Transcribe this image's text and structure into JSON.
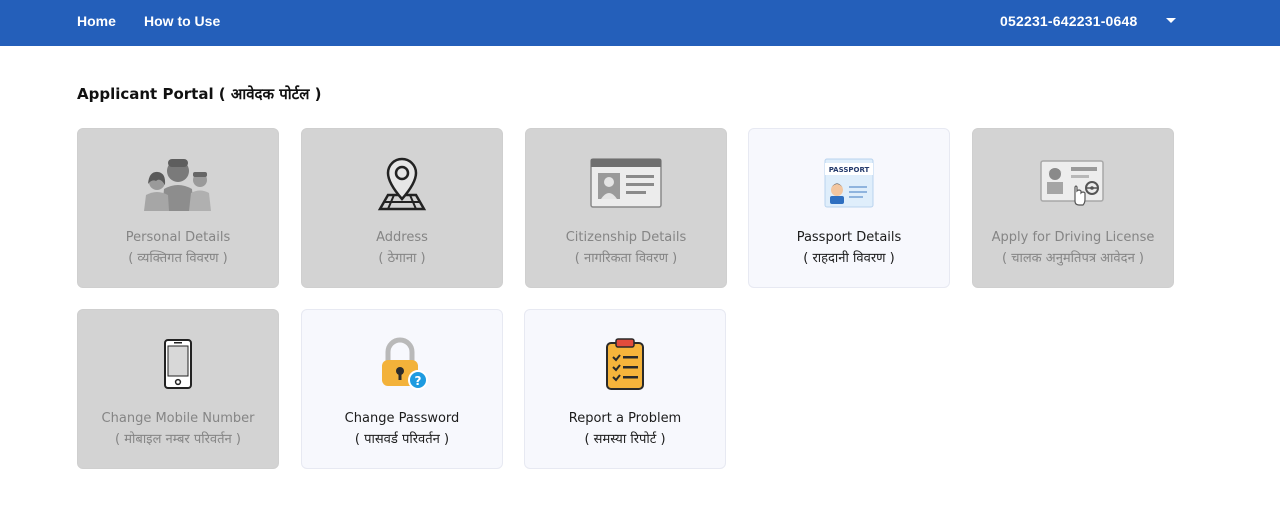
{
  "nav": {
    "home": "Home",
    "how_to_use": "How to Use",
    "user_id": "052231-642231-0648"
  },
  "page": {
    "title": "Applicant Portal ( आवेदक पोर्टल )"
  },
  "cards": [
    {
      "en": "Personal Details",
      "ne": "( व्यक्तिगत विवरण )",
      "icon": "people-icon",
      "state": "disabled"
    },
    {
      "en": "Address",
      "ne": "( ठेगाना )",
      "icon": "map-pin-icon",
      "state": "disabled"
    },
    {
      "en": "Citizenship Details",
      "ne": "( नागरिकता विवरण )",
      "icon": "id-card-icon",
      "state": "disabled"
    },
    {
      "en": "Passport Details",
      "ne": "( राहदानी विवरण )",
      "icon": "passport-icon",
      "state": "enabled"
    },
    {
      "en": "Apply for Driving License",
      "ne": "( चालक अनुमतिपत्र आवेदन )",
      "icon": "driving-license-icon",
      "state": "disabled"
    },
    {
      "en": "Change Mobile Number",
      "ne": "( मोबाइल नम्बर परिवर्तन )",
      "icon": "mobile-phone-icon",
      "state": "disabled"
    },
    {
      "en": "Change Password",
      "ne": "( पासवर्ड परिवर्तन )",
      "icon": "padlock-icon",
      "state": "enabled"
    },
    {
      "en": "Report a Problem",
      "ne": "( समस्या रिपोर्ट )",
      "icon": "clipboard-checklist-icon",
      "state": "enabled"
    }
  ],
  "colors": {
    "header_bg": "#245fba",
    "disabled_card_bg": "#d3d3d3",
    "enabled_card_bg": "#f7f8fd"
  }
}
